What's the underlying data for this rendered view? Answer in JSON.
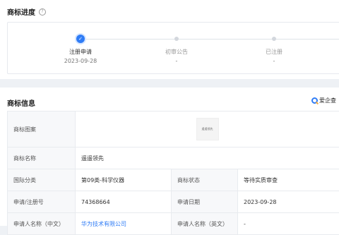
{
  "progress": {
    "title": "商标进度",
    "steps": [
      {
        "label": "注册申请",
        "date": "2023-09-28"
      },
      {
        "label": "初审公告",
        "date": "-"
      },
      {
        "label": "已注册",
        "date": "-"
      }
    ]
  },
  "info": {
    "title": "商标信息",
    "badge": "爱企查",
    "image_label": "商标图案",
    "image_text": "遥遥领先",
    "name_label": "商标名称",
    "name_value": "遥遥领先",
    "class_label": "国际分类",
    "class_value": "第09类-科学仪器",
    "status_label": "商标状态",
    "status_value": "等待实质审查",
    "regno_label": "申请/注册号",
    "regno_value": "74368664",
    "date_label": "申请日期",
    "date_value": "2023-09-28",
    "applicant_cn_label": "申请人名称（中文）",
    "applicant_cn_value": "华为技术有限公司",
    "applicant_en_label": "申请人名称（英文）",
    "applicant_en_value": "-"
  },
  "colors": {
    "accent": "#2f7cf6"
  },
  "icons": {
    "help": "question-circle-icon",
    "done": "check-icon",
    "brand": "aiqicha-logo-icon"
  }
}
